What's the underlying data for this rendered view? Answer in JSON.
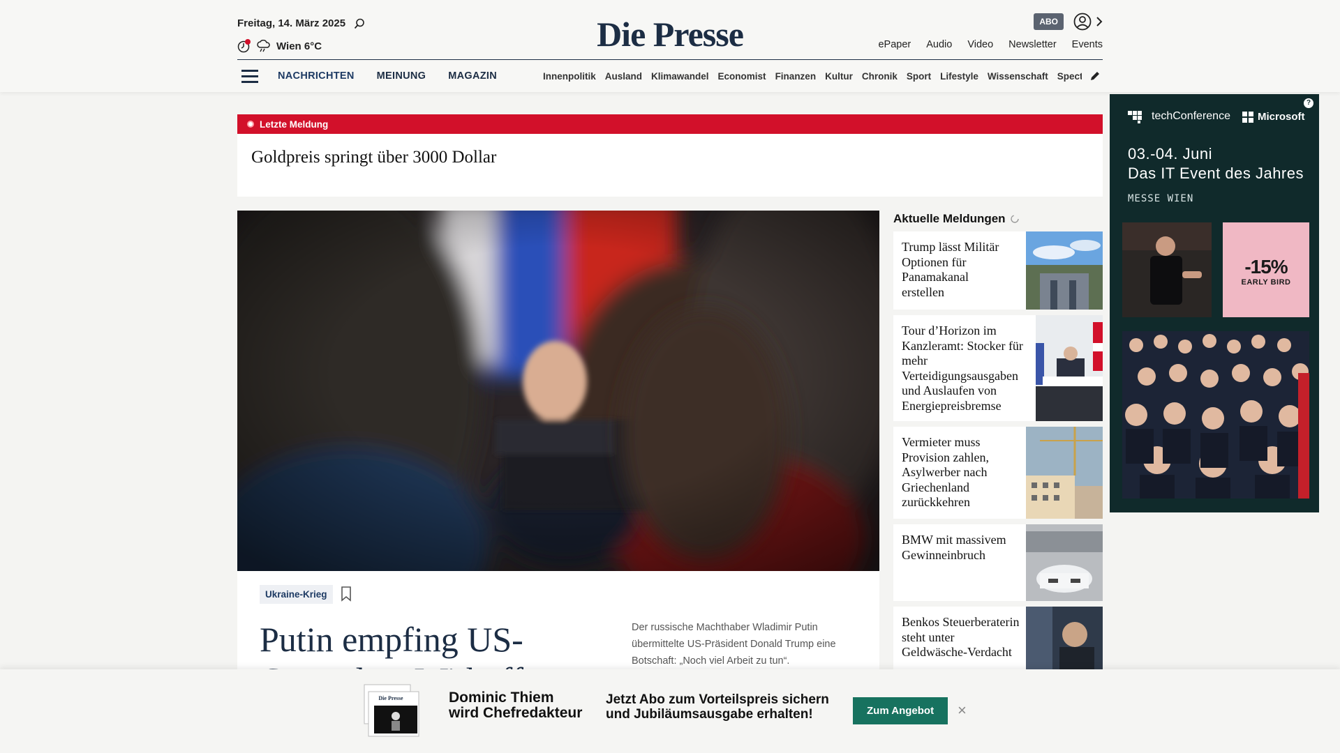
{
  "header": {
    "date": "Freitag, 14. März 2025",
    "weather": "Wien 6°C",
    "logo": "Die Presse",
    "abo_label": "ABO",
    "links": [
      "ePaper",
      "Audio",
      "Video",
      "Newsletter",
      "Events"
    ]
  },
  "nav": {
    "main": [
      "NACHRICHTEN",
      "MEINUNG",
      "MAGAZIN"
    ],
    "sub": [
      "Innenpolitik",
      "Ausland",
      "Klimawandel",
      "Economist",
      "Finanzen",
      "Kultur",
      "Chronik",
      "Sport",
      "Lifestyle",
      "Wissenschaft",
      "Spectrum"
    ]
  },
  "breaking": {
    "label": "Letzte Meldung",
    "title": "Goldpreis springt über 3000 Dollar"
  },
  "hero": {
    "tag": "Ukraine-Krieg",
    "headline": "Putin empfing US-Gesandten Witkoff",
    "lead": "Der russische Machthaber Wladimir Putin übermittelte US-Präsident Donald Trump eine Botschaft: „Noch viel Arbeit zu tun“."
  },
  "aktuelle": {
    "title": "Aktuelle Meldungen",
    "items": [
      "Trump lässt Militär Optionen für Panamakanal erstellen",
      "Tour d’Horizon im Kanzleramt: Stocker für mehr Verteidigungsausgaben und Auslaufen von Energiepreisbremse",
      "Vermieter muss Provision zahlen, Asylwerber nach Griechenland zurückkehren",
      "BMW mit massivem Gewinneinbruch",
      "Benkos Steuerberaterin steht unter Geldwäsche-Verdacht"
    ]
  },
  "ad": {
    "brand": "techConference",
    "partner": "Microsoft",
    "date_line1": "03.-04. Juni",
    "date_line2": "Das IT Event des Jahres",
    "location": "MESSE WIEN",
    "discount": "-15%",
    "discount_label": "EARLY BIRD",
    "help": "?"
  },
  "banner": {
    "name_line1": "Dominic Thiem",
    "name_line2": "wird Chefredakteur",
    "offer_line1": "Jetzt Abo zum Vorteilspreis sichern",
    "offer_line2": "und Jubiläumsausgabe erhalten!",
    "button": "Zum Angebot",
    "close": "×",
    "paper_logo": "Die Presse"
  }
}
